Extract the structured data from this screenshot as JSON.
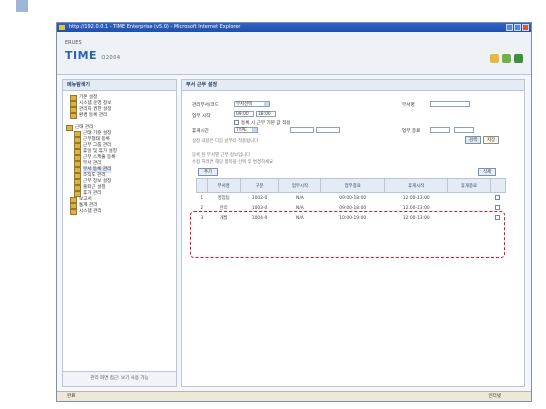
{
  "window": {
    "title": "http://192.0.0.1 - TIME Enterprise (v5.0) - Microsoft Internet Explorer"
  },
  "header": {
    "brand_small": "ERUES",
    "logo": "TIME",
    "logo_sub": "Q2004"
  },
  "sidebar": {
    "title": "메뉴탐색기",
    "items": [
      "기본 설정",
      "시스템 운영 정보",
      "관리자 권한 설정",
      "환경 등록 관리",
      "근태 관리",
      "근태 기준 설정",
      "근무형태 등록",
      "근무 그룹 관리",
      "휴일 및 휴가 설정",
      "근무 스케줄 등록",
      "부서 관리",
      "부서 등록 관리",
      "조직도 관리",
      "근무 정보 설정",
      "출퇴근 설정",
      "휴가 관리",
      "보고서",
      "통계 관리",
      "시스템 관리"
    ],
    "selected_index": 11,
    "footer": "관리 화면 접근: 보기 사용 가능"
  },
  "main": {
    "title": "부서 근무 설정",
    "labels": {
      "dept_code": "관리부서/코드",
      "dept_name": "부서명",
      "work_time": "업무 시작",
      "break_time": "휴게시간",
      "reg_check": "등록 시 근무 기본 값 적용",
      "end_time": "업무 종료",
      "note1": "설정 내용은 다음 날부터 적용됩니다",
      "note2": "등록 된 부서별 근무 정보입니다",
      "note3": "수정 하려면 해당 항목을 선택 후 변경하세요"
    },
    "values": {
      "dept_select": "부서선택",
      "time1": "09:00",
      "time2": "18:00",
      "type": "TYPE"
    },
    "buttons": {
      "search": "검색",
      "save": "저장",
      "add": "추가",
      "delete": "삭제"
    },
    "table": {
      "headers": [
        "번호",
        "부서명",
        "구분",
        "업무시작",
        "업무종료",
        "휴게시작",
        "휴게종료"
      ],
      "rows": [
        [
          "1",
          "영업팀",
          "1002-0",
          "N/A",
          "09:00-18:00",
          "12:00-13:00"
        ],
        [
          "2",
          "관리",
          "1003-0",
          "N/A",
          "09:00-18:00",
          "12:00-13:00"
        ],
        [
          "3",
          "개발",
          "1004-0",
          "N/A",
          "10:00-19:00",
          "12:00-13:00"
        ]
      ]
    }
  },
  "status": {
    "left": "완료",
    "right": "인터넷"
  },
  "colors": {
    "title_bar": "#1f4fa8",
    "highlight": "#e3141a",
    "accent": "#2a62b8"
  }
}
